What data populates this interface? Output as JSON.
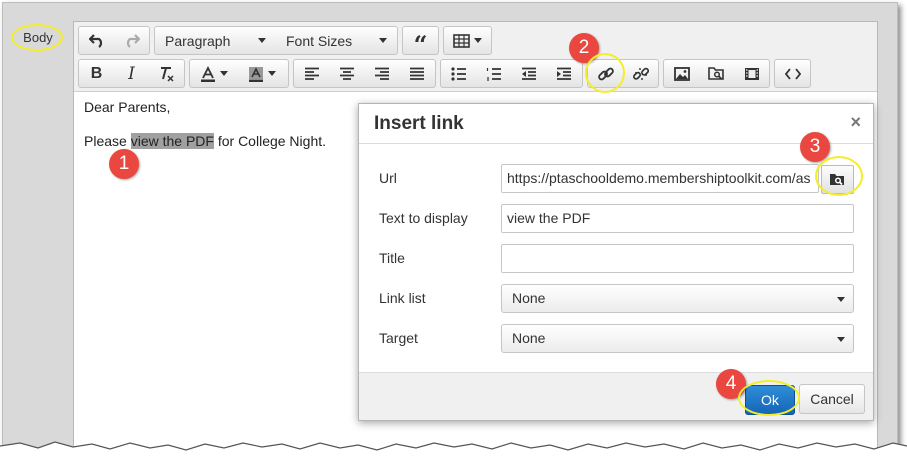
{
  "body_label": "Body",
  "toolbar": {
    "block_format": "Paragraph",
    "font_sizes": "Font Sizes"
  },
  "content": {
    "line1": "Dear Parents,",
    "line2_before": "Please ",
    "line2_selected": "view the PDF",
    "line2_after": " for College Night."
  },
  "dialog": {
    "title": "Insert link",
    "close": "×",
    "url_label": "Url",
    "url_value": "https://ptaschooldemo.membershiptoolkit.com/as",
    "text_label": "Text to display",
    "text_value": "view the PDF",
    "title_label": "Title",
    "title_value": "",
    "link_list_label": "Link list",
    "link_list_value": "None",
    "target_label": "Target",
    "target_value": "None",
    "ok_label": "Ok",
    "cancel_label": "Cancel"
  },
  "callouts": {
    "n1": "1",
    "n2": "2",
    "n3": "3",
    "n4": "4"
  },
  "colors": {
    "highlight": "#f4ee2a",
    "callout": "#e9473f",
    "ok_button": "#1f78c8"
  }
}
